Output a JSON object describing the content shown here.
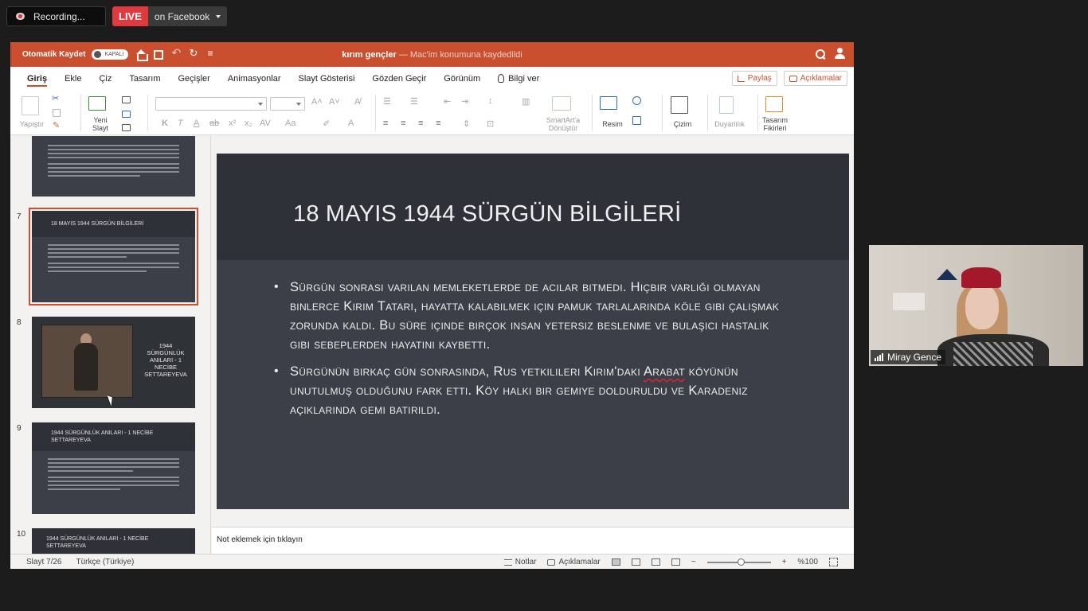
{
  "meeting": {
    "recording_label": "Recording...",
    "live_label": "LIVE",
    "live_target": "on Facebook"
  },
  "titlebar": {
    "autosave_label": "Otomatik Kaydet",
    "autosave_state": "KAPALI",
    "document_name": "kırım gençler",
    "save_status": " — Mac'im konumuna kaydedildi"
  },
  "tabs": {
    "items": [
      "Giriş",
      "Ekle",
      "Çiz",
      "Tasarım",
      "Geçişler",
      "Animasyonlar",
      "Slayt Gösterisi",
      "Gözden Geçir",
      "Görünüm"
    ],
    "tell_me": "Bilgi ver",
    "share": "Paylaş",
    "comments": "Açıklamalar"
  },
  "ribbon": {
    "paste": "Yapıştır",
    "new_slide_line1": "Yeni",
    "new_slide_line2": "Slayt",
    "smartart_line1": "SmartArt'a",
    "smartart_line2": "Dönüştür",
    "picture": "Resim",
    "draw": "Çizim",
    "sensitivity": "Duyarlılık",
    "designer_line1": "Tasarım",
    "designer_line2": "Fikirleri"
  },
  "thumbnails": {
    "slide7": {
      "number": "7",
      "title": "18 MAYIS 1944 SÜRGÜN BİLGİLERİ"
    },
    "slide8": {
      "number": "8",
      "title": "1944 SÜRGÜNLÜK ANILARI - 1 NECİBE SETTAREYEVA"
    },
    "slide9": {
      "number": "9",
      "title": "1944 SÜRGÜNLÜK ANILARI - 1 NECİBE SETTAREYEVA"
    },
    "slide10": {
      "number": "10",
      "title": "1944 SÜRGÜNLÜK ANILARI - 1 NECİBE SETTAREYEVA"
    }
  },
  "slide": {
    "title": "18 MAYIS 1944 SÜRGÜN BİLGİLERİ",
    "bullet1": "Sürgün sonrası varılan memleketlerde de acılar bitmedi. Hiçbir varlığı olmayan binlerce Kırım Tatarı, hayatta kalabilmek için pamuk tarlalarında köle gibi çalışmak zorunda kaldı. Bu süre içinde birçok insan yetersiz beslenme ve bulaşıcı hastalık gibi sebeplerden hayatını kaybetti.",
    "bullet2_pre": "Sürgünün birkaç gün sonrasında, Rus yetkilileri Kırım'daki ",
    "bullet2_flagged": "Arabat",
    "bullet2_post": " köyünün unutulmuş olduğunu fark etti. Köy halkı bir gemiye dolduruldu ve Karadeniz açıklarında gemi batırıldı."
  },
  "notes_placeholder": "Not eklemek için tıklayın",
  "statusbar": {
    "slide_position": "Slayt 7/26",
    "language": "Türkçe (Türkiye)",
    "notes": "Notlar",
    "comments": "Açıklamalar",
    "zoom": "%100"
  },
  "webcam": {
    "participant_name": "Miray Gence"
  }
}
